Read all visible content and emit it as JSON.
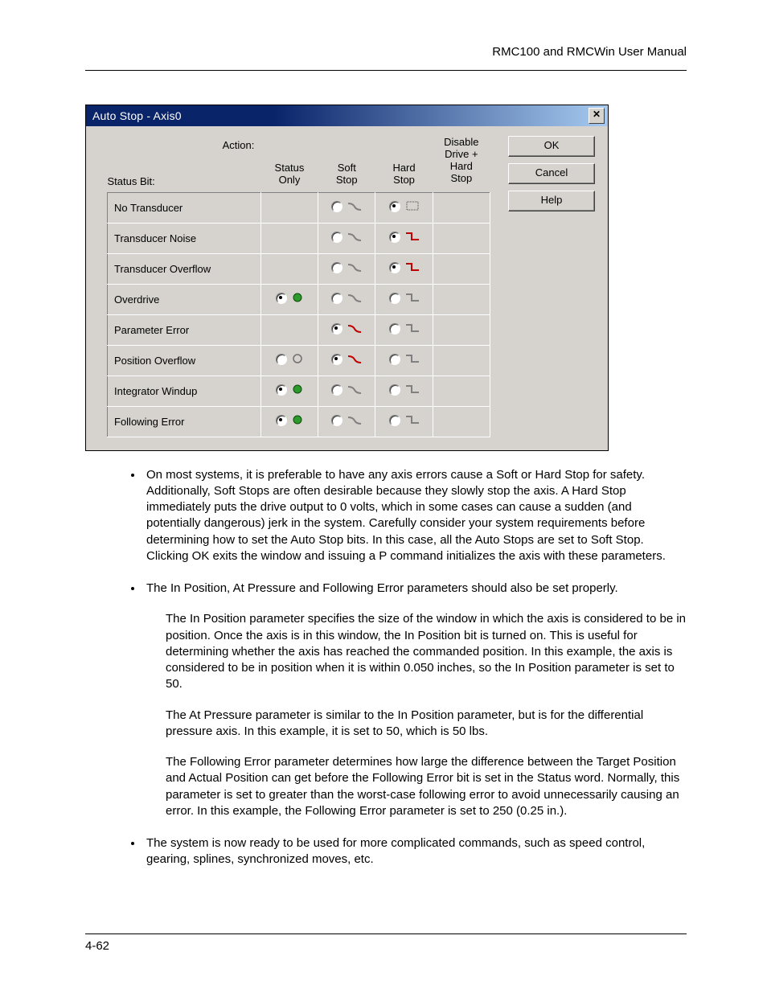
{
  "header": {
    "manual_title": "RMC100 and RMCWin User Manual"
  },
  "footer": {
    "page_num": "4-62"
  },
  "dialog": {
    "title": "Auto Stop - Axis0",
    "buttons": {
      "ok": "OK",
      "cancel": "Cancel",
      "help": "Help"
    },
    "headers": {
      "action": "Action:",
      "status_bit": "Status Bit:",
      "cols": [
        "Status\nOnly",
        "Soft\nStop",
        "Hard\nStop",
        "Disable\nDrive +\nHard\nStop"
      ]
    },
    "rows": [
      {
        "label": "No Transducer",
        "cells": [
          null,
          {
            "sel": false,
            "icon": "soft-gray"
          },
          {
            "sel": true,
            "icon": "hard-dotted"
          },
          null
        ]
      },
      {
        "label": "Transducer Noise",
        "cells": [
          null,
          {
            "sel": false,
            "icon": "soft-gray"
          },
          {
            "sel": true,
            "icon": "hard-red"
          },
          null
        ]
      },
      {
        "label": "Transducer Overflow",
        "cells": [
          null,
          {
            "sel": false,
            "icon": "soft-gray"
          },
          {
            "sel": true,
            "icon": "hard-red"
          },
          null
        ]
      },
      {
        "label": "Overdrive",
        "cells": [
          {
            "sel": true,
            "icon": "status-green"
          },
          {
            "sel": false,
            "icon": "soft-gray"
          },
          {
            "sel": false,
            "icon": "hard-gray"
          },
          null
        ]
      },
      {
        "label": "Parameter Error",
        "cells": [
          null,
          {
            "sel": true,
            "icon": "soft-red"
          },
          {
            "sel": false,
            "icon": "hard-gray"
          },
          null
        ]
      },
      {
        "label": "Position Overflow",
        "cells": [
          {
            "sel": false,
            "icon": "status-gray"
          },
          {
            "sel": true,
            "icon": "soft-red"
          },
          {
            "sel": false,
            "icon": "hard-gray"
          },
          null
        ]
      },
      {
        "label": "Integrator Windup",
        "cells": [
          {
            "sel": true,
            "icon": "status-green"
          },
          {
            "sel": false,
            "icon": "soft-gray"
          },
          {
            "sel": false,
            "icon": "hard-gray"
          },
          null
        ]
      },
      {
        "label": "Following Error",
        "cells": [
          {
            "sel": true,
            "icon": "status-green"
          },
          {
            "sel": false,
            "icon": "soft-gray"
          },
          {
            "sel": false,
            "icon": "hard-gray"
          },
          null
        ]
      }
    ]
  },
  "body": {
    "b1": "On most systems, it is preferable to have any axis errors cause a Soft or Hard Stop for safety. Additionally, Soft Stops are often desirable because they slowly stop the axis. A Hard Stop immediately puts the drive output to 0 volts, which in some cases can cause a sudden (and potentially dangerous) jerk in the system. Carefully consider your system requirements before determining how to set the Auto Stop bits. In this case, all the Auto Stops are set to Soft Stop. Clicking OK exits the window and issuing a P command initializes the axis with these parameters.",
    "b2": "The In Position, At Pressure and Following Error parameters should also be set properly.",
    "b2a": "The In Position parameter specifies the size of the window in which the axis is considered to be in position. Once the axis is in this window, the In Position bit is turned on. This is useful for determining whether the axis has reached the commanded position. In this example, the axis is considered to be in position when it is within 0.050 inches, so the In Position parameter is set to 50.",
    "b2b": "The At Pressure parameter is similar to the In Position parameter, but is for the differential pressure axis. In this example, it is set to 50, which is 50 lbs.",
    "b2c": "The Following Error parameter determines how large the difference between the Target Position and Actual Position can get before the Following Error bit is set in the Status word. Normally, this parameter is set to greater than the worst-case following error to avoid unnecessarily causing an error. In this example, the Following Error parameter is set to 250 (0.25 in.).",
    "b3": "The system is now ready to be used for more complicated commands, such as speed control, gearing, splines, synchronized moves, etc."
  }
}
